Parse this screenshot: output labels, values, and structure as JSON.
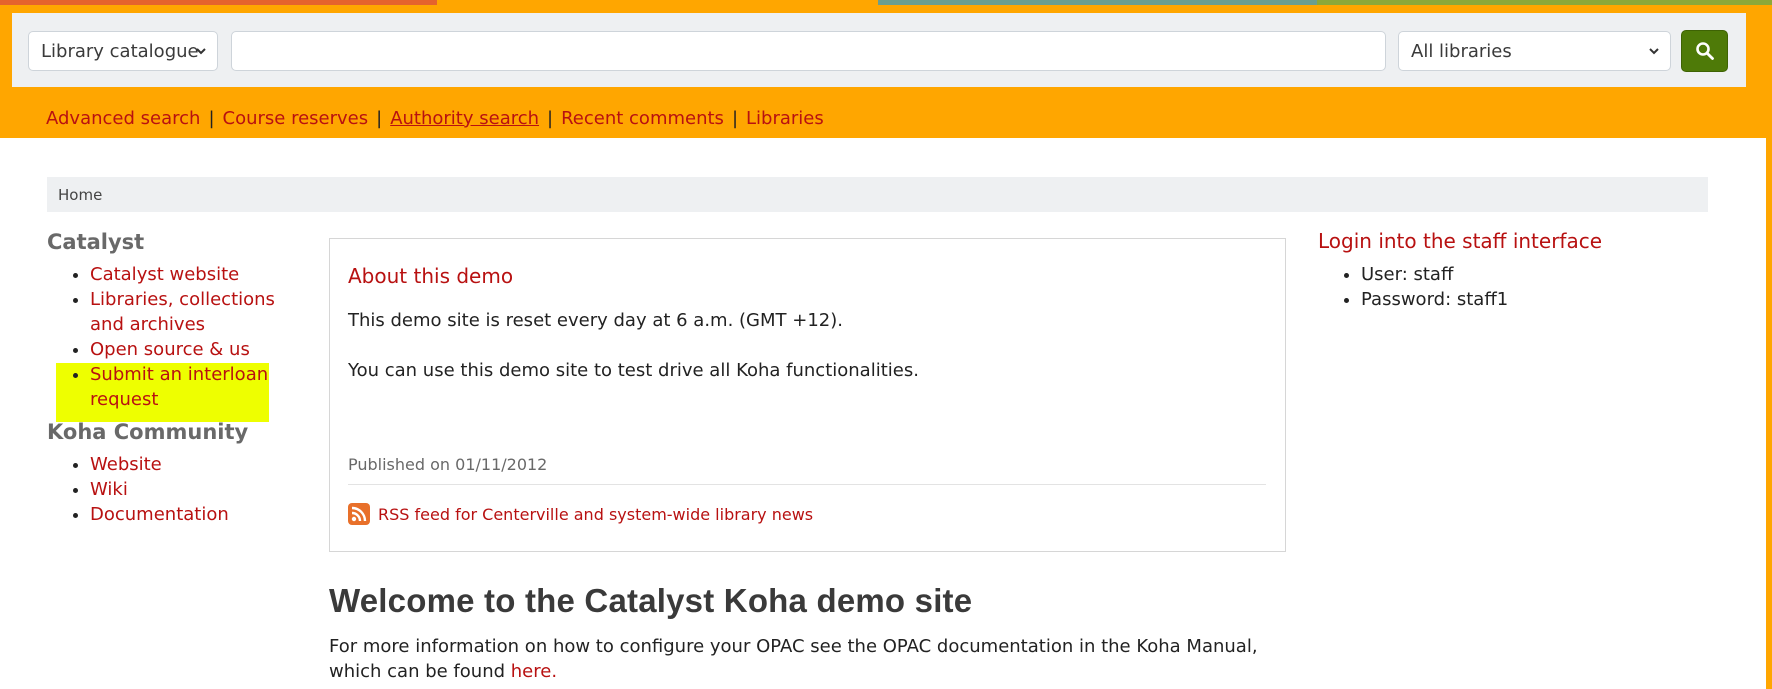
{
  "colors": {
    "header": "#FFA600",
    "panel": "#EEF0F2",
    "link": "#B81111",
    "search_button": "#4E7A08",
    "highlight": "#EEFF00",
    "strip": [
      "#E5632D",
      "#FFA600",
      "#6B9E8F",
      "#8CA83A"
    ]
  },
  "search": {
    "scope_selected": "Library catalogue",
    "query_value": "",
    "library_selected": "All libraries",
    "button_icon": "search-icon"
  },
  "moresearches": [
    {
      "label": "Advanced search"
    },
    {
      "label": "Course reserves"
    },
    {
      "label": "Authority search"
    },
    {
      "label": "Recent comments"
    },
    {
      "label": "Libraries"
    }
  ],
  "breadcrumb": {
    "home": "Home"
  },
  "sidebar": {
    "catalyst_heading": "Catalyst",
    "catalyst_links": [
      "Catalyst website",
      "Libraries, collections and archives",
      "Open source & us",
      "Submit an interloan request"
    ],
    "koha_heading": "Koha Community",
    "koha_links": [
      "Website",
      "Wiki",
      "Documentation"
    ]
  },
  "news": {
    "title": "About this demo",
    "p1": "This demo site is reset every day at 6 a.m. (GMT +12).",
    "p2": "You can use this demo site to test drive all Koha functionalities.",
    "published": "Published on 01/11/2012",
    "rss_icon": "rss-icon",
    "rss_label": "RSS feed for Centerville and system-wide library news"
  },
  "welcome": {
    "title": "Welcome to the Catalyst Koha demo site",
    "text": "For more information on how to configure your OPAC see the OPAC documentation in the Koha Manual, which can be found",
    "link": "here."
  },
  "login": {
    "heading": "Login into the staff interface",
    "items": [
      "User: staff",
      "Password: staff1"
    ]
  }
}
